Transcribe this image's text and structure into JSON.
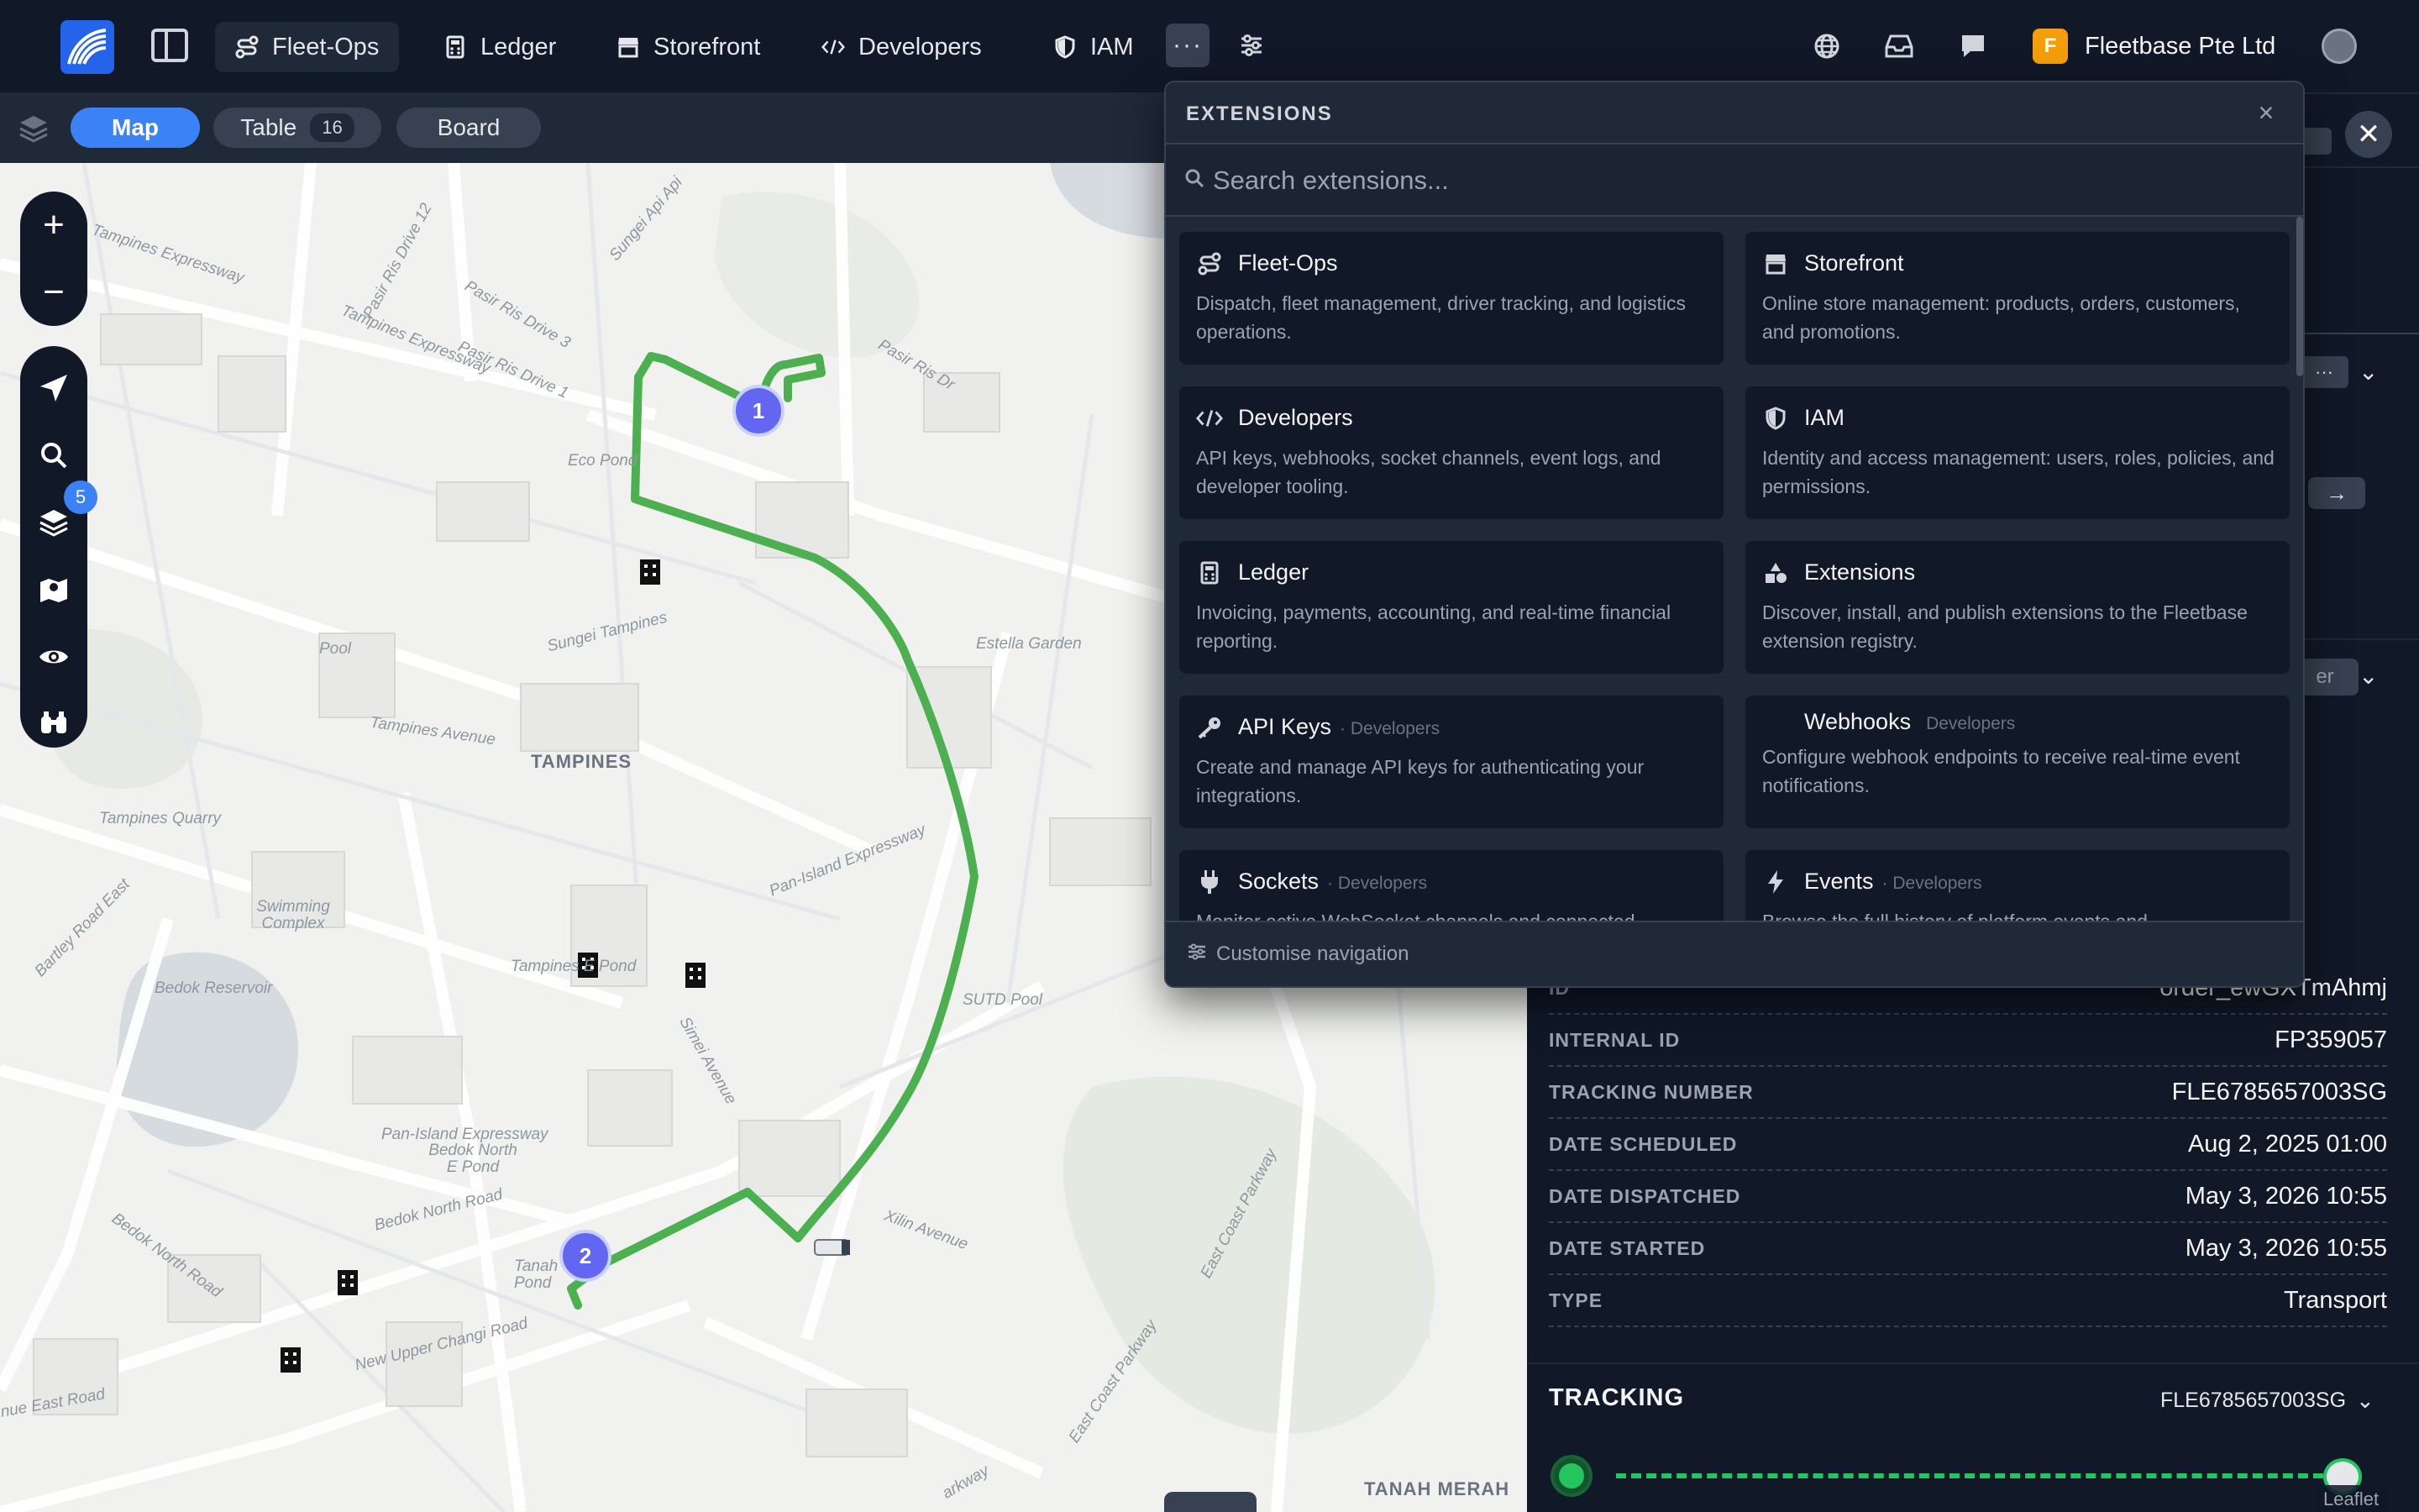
{
  "nav": {
    "items": [
      {
        "label": "Fleet-Ops",
        "icon": "route-icon",
        "active": true
      },
      {
        "label": "Ledger",
        "icon": "calculator-icon"
      },
      {
        "label": "Storefront",
        "icon": "store-icon"
      },
      {
        "label": "Developers",
        "icon": "code-icon"
      },
      {
        "label": "IAM",
        "icon": "shield-icon"
      }
    ],
    "org_initial": "F",
    "org_name": "Fleetbase Pte Ltd"
  },
  "toolbar": {
    "tabs": [
      {
        "label": "Map",
        "active": true
      },
      {
        "label": "Table",
        "count": "16"
      },
      {
        "label": "Board"
      }
    ]
  },
  "map": {
    "layers_badge": "5",
    "markers": [
      "1",
      "2"
    ],
    "labels": {
      "tampines_expressway": "Tampines Expressway",
      "tampines_expressway_2": "Tampines Expressway",
      "pasir_ris_drive_12": "Pasir Ris Drive 12",
      "pasir_ris_drive_3": "Pasir Ris Drive 3",
      "pasir_ris_drive_1": "Pasir Ris Drive 1",
      "pasir_ris_dr": "Pasir Ris Dr",
      "sungei_api_api": "Sungei Api Api",
      "eco_pond": "Eco Pond",
      "sungei_tampines": "Sungei Tampines",
      "estella_garden": "Estella Garden",
      "pool": "Pool",
      "tampines_avenue": "Tampines Avenue",
      "tampines": "TAMPINES",
      "tampines_quarry": "Tampines Quarry",
      "swimming_complex": "Swimming Complex",
      "bartley_road_east": "Bartley Road East",
      "bedok_reservoir": "Bedok Reservoir",
      "tampines_e_pond": "Tampines E Pond",
      "pan_island_expressway": "Pan-Island Expressway",
      "pan_island_expressway_2": "Pan-Island Expressway",
      "sutd_pool": "SUTD Pool",
      "simei_avenue": "Simei Avenue",
      "bedok_north_e_pond": "Bedok North E Pond",
      "bedok_north_road": "Bedok North Road",
      "bedok_north_road_2": "Bedok North Road",
      "xilin_avenue": "Xilin Avenue",
      "east_coast_parkway": "East Coast Parkway",
      "east_coast_parkway_2": "East Coast Parkway",
      "new_upper_changi_road": "New Upper Changi Road",
      "tanah_merah": "TANAH MERAH",
      "tanah_pond": "Tanah Pond",
      "nue_east_road": "nue East Road",
      "parkway": "arkway"
    }
  },
  "extensions": {
    "title": "EXTENSIONS",
    "search_placeholder": "Search extensions...",
    "cards": [
      {
        "name": "Fleet-Ops",
        "icon": "route-icon",
        "desc": "Dispatch, fleet management, driver tracking, and logistics operations."
      },
      {
        "name": "Storefront",
        "icon": "store-icon",
        "desc": "Online store management: products, orders, customers, and promotions."
      },
      {
        "name": "Developers",
        "icon": "code-icon",
        "desc": "API keys, webhooks, socket channels, event logs, and developer tooling."
      },
      {
        "name": "IAM",
        "icon": "shield-icon",
        "desc": "Identity and access management: users, roles, policies, and permissions."
      },
      {
        "name": "Ledger",
        "icon": "calculator-icon",
        "desc": "Invoicing, payments, accounting, and real-time financial reporting."
      },
      {
        "name": "Extensions",
        "icon": "shapes-icon",
        "desc": "Discover, install, and publish extensions to the Fleetbase extension registry."
      },
      {
        "name": "API Keys",
        "sub": "· Developers",
        "icon": "key-icon",
        "desc": "Create and manage API keys for authenticating your integrations."
      },
      {
        "name": "Webhooks",
        "sub": "Developers",
        "icon": "",
        "desc": "Configure webhook endpoints to receive real-time event notifications."
      },
      {
        "name": "Sockets",
        "sub": "· Developers",
        "icon": "plug-icon",
        "desc": "Monitor active WebSocket channels and connected"
      },
      {
        "name": "Events",
        "sub": "· Developers",
        "icon": "bolt-icon",
        "desc": "Browse the full history of platform events and"
      }
    ],
    "footer": "Customise navigation"
  },
  "details": {
    "partial_id_key": "ID",
    "partial_id_val": "order_ewGXTmAhmj",
    "rows": [
      {
        "key": "INTERNAL ID",
        "value": "FP359057"
      },
      {
        "key": "TRACKING NUMBER",
        "value": "FLE6785657003SG"
      },
      {
        "key": "DATE SCHEDULED",
        "value": "Aug 2, 2025 01:00"
      },
      {
        "key": "DATE DISPATCHED",
        "value": "May 3, 2026 10:55"
      },
      {
        "key": "DATE STARTED",
        "value": "May 3, 2026 10:55"
      },
      {
        "key": "TYPE",
        "value": "Transport"
      }
    ],
    "partial_right_1": "er",
    "tracking_title": "TRACKING",
    "tracking_number": "FLE6785657003SG"
  },
  "attribution": "Leaflet",
  "colors": {
    "accent": "#3b82f6",
    "route": "#4caf50",
    "marker": "#6366f1",
    "tracking": "#22c55e"
  }
}
